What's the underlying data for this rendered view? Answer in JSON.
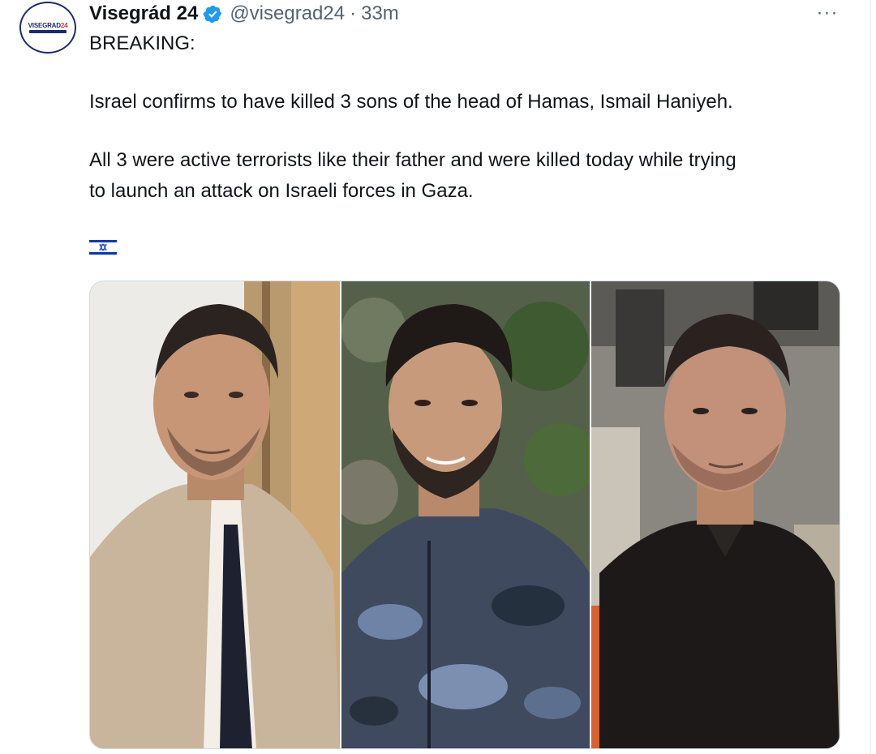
{
  "tweet": {
    "display_name": "Visegrád 24",
    "handle": "@visegrad24",
    "separator": "·",
    "time": "33m",
    "more_label": "···",
    "avatar_text_a": "VISEGRAD",
    "avatar_text_b": "24",
    "lines": [
      "BREAKING:",
      "Israel confirms to have killed 3 sons of the head of Hamas, Ismail Haniyeh.",
      "All 3 were active terrorists like their father and were killed today while trying",
      "to launch an attack on Israeli forces in Gaza."
    ],
    "flag_icon": "israel-flag-emoji",
    "verified_icon": "verified-badge-icon",
    "photos": [
      {
        "name": "photo-man-in-beige-suit"
      },
      {
        "name": "photo-man-in-camo-jacket"
      },
      {
        "name": "photo-man-in-black-shirt"
      }
    ]
  },
  "colors": {
    "text": "#0f1419",
    "secondary": "#536471",
    "verified": "#1d9bf0",
    "flag_blue": "#0038b8"
  }
}
